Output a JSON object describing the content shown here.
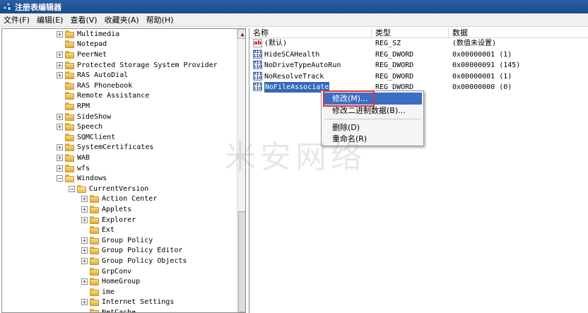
{
  "window": {
    "title": "注册表编辑器",
    "icon": "regedit-icon"
  },
  "menubar": {
    "items": [
      "文件(F)",
      "编辑(E)",
      "查看(V)",
      "收藏夹(A)",
      "帮助(H)"
    ]
  },
  "tree": {
    "rows": [
      {
        "label": "Multimedia",
        "expandable": true,
        "expanded": false
      },
      {
        "label": "Notepad",
        "expandable": false,
        "expanded": false
      },
      {
        "label": "PeerNet",
        "expandable": true,
        "expanded": false
      },
      {
        "label": "Protected Storage System Provider",
        "expandable": true,
        "expanded": false
      },
      {
        "label": "RAS AutoDial",
        "expandable": true,
        "expanded": false
      },
      {
        "label": "RAS Phonebook",
        "expandable": false,
        "expanded": false
      },
      {
        "label": "Remote Assistance",
        "expandable": false,
        "expanded": false
      },
      {
        "label": "RPM",
        "expandable": false,
        "expanded": false
      },
      {
        "label": "SideShow",
        "expandable": true,
        "expanded": false
      },
      {
        "label": "Speech",
        "expandable": true,
        "expanded": false
      },
      {
        "label": "SQMClient",
        "expandable": false,
        "expanded": false
      },
      {
        "label": "SystemCertificates",
        "expandable": true,
        "expanded": false
      },
      {
        "label": "WAB",
        "expandable": true,
        "expanded": false
      },
      {
        "label": "wfs",
        "expandable": true,
        "expanded": false
      },
      {
        "label": "Windows",
        "expandable": true,
        "expanded": true
      },
      {
        "label": "CurrentVersion",
        "expandable": true,
        "expanded": true
      },
      {
        "label": "Action Center",
        "expandable": true,
        "expanded": false
      },
      {
        "label": "Applets",
        "expandable": true,
        "expanded": false
      },
      {
        "label": "Explorer",
        "expandable": true,
        "expanded": false
      },
      {
        "label": "Ext",
        "expandable": false,
        "expanded": false
      },
      {
        "label": "Group Policy",
        "expandable": true,
        "expanded": false
      },
      {
        "label": "Group Policy Editor",
        "expandable": true,
        "expanded": false
      },
      {
        "label": "Group Policy Objects",
        "expandable": true,
        "expanded": false
      },
      {
        "label": "GrpConv",
        "expandable": false,
        "expanded": false
      },
      {
        "label": "HomeGroup",
        "expandable": true,
        "expanded": false
      },
      {
        "label": "ime",
        "expandable": false,
        "expanded": false
      },
      {
        "label": "Internet Settings",
        "expandable": true,
        "expanded": false
      },
      {
        "label": "NetCache",
        "expandable": false,
        "expanded": false
      }
    ]
  },
  "values": {
    "headers": {
      "name": "名称",
      "type": "类型",
      "data": "数据"
    },
    "rows": [
      {
        "name": "(默认)",
        "type": "REG_SZ",
        "data": "(数值未设置)",
        "icon": "string-value-icon"
      },
      {
        "name": "HideSCAHealth",
        "type": "REG_DWORD",
        "data": "0x00000001 (1)",
        "icon": "dword-value-icon"
      },
      {
        "name": "NoDriveTypeAutoRun",
        "type": "REG_DWORD",
        "data": "0x00000091 (145)",
        "icon": "dword-value-icon"
      },
      {
        "name": "NoResolveTrack",
        "type": "REG_DWORD",
        "data": "0x00000001 (1)",
        "icon": "dword-value-icon"
      },
      {
        "name": "NoFileAssociate",
        "type": "REG_DWORD",
        "data": "0x00000000 (0)",
        "icon": "dword-value-icon",
        "selected": true
      }
    ]
  },
  "context_menu": {
    "modify": "修改(M)...",
    "modify_binary": "修改二进制数据(B)...",
    "delete": "删除(D)",
    "rename": "重命名(R)"
  },
  "icons": {
    "string_glyph": "ab",
    "binary_glyph_top": "011",
    "binary_glyph_bottom": "110"
  },
  "watermark": "米安网络",
  "colors": {
    "titlebar": "#1c4a8c",
    "selection": "#3468b8",
    "highlight_box": "#e53030"
  }
}
